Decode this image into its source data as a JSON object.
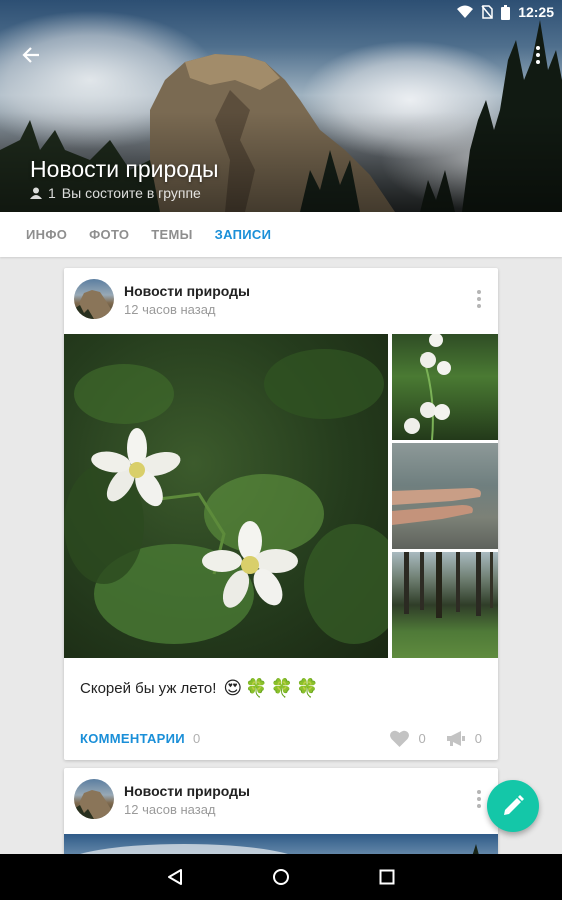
{
  "status_bar": {
    "time": "12:25"
  },
  "header": {
    "group_name": "Новости природы",
    "members_count": "1",
    "membership_text": "Вы состоите в группе"
  },
  "tabs": [
    {
      "label": "ИНФО",
      "active": false
    },
    {
      "label": "ФОТО",
      "active": false
    },
    {
      "label": "ТЕМЫ",
      "active": false
    },
    {
      "label": "ЗАПИСИ",
      "active": true
    }
  ],
  "posts": [
    {
      "author": "Новости природы",
      "time": "12 часов назад",
      "text": "Скорей бы уж лето!",
      "emojis": [
        "😍",
        "🍀",
        "🍀",
        "🍀"
      ],
      "comments_label": "КОММЕНТАРИИ",
      "comments_count": "0",
      "likes_count": "0",
      "shares_count": "0"
    },
    {
      "author": "Новости природы",
      "time": "12 часов назад"
    }
  ],
  "colors": {
    "accent": "#1a8fd8",
    "fab": "#14c7a8"
  },
  "icons": [
    "back-arrow-icon",
    "more-vert-icon",
    "person-icon",
    "heart-icon",
    "megaphone-icon",
    "pencil-icon",
    "nav-back-icon",
    "nav-home-icon",
    "nav-recents-icon"
  ]
}
